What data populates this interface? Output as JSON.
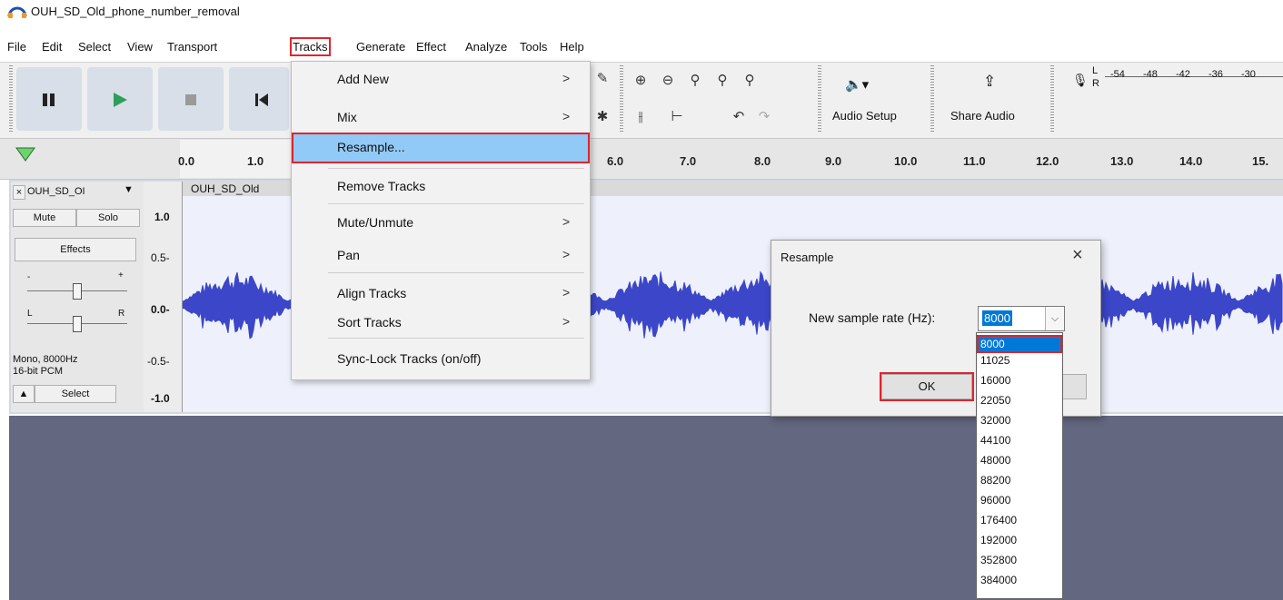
{
  "window": {
    "title": "OUH_SD_Old_phone_number_removal"
  },
  "menubar": [
    "File",
    "Edit",
    "Select",
    "View",
    "Transport",
    "Tracks",
    "Generate",
    "Effect",
    "Analyze",
    "Tools",
    "Help"
  ],
  "toolbar": {
    "audio_setup": "Audio Setup",
    "share_audio": "Share Audio",
    "meter_lr": [
      "L",
      "R"
    ],
    "meter_ticks": [
      "-54",
      "-48",
      "-42",
      "-36",
      "-30"
    ]
  },
  "timeline": {
    "ticks": [
      "0.0",
      "1.0",
      "6.0",
      "7.0",
      "8.0",
      "9.0",
      "10.0",
      "11.0",
      "12.0",
      "13.0",
      "14.0",
      "15."
    ]
  },
  "track": {
    "name": "OUH_SD_OI",
    "clip_name": "OUH_SD_Old",
    "mute": "Mute",
    "solo": "Solo",
    "effects": "Effects",
    "gain_minus": "-",
    "gain_plus": "+",
    "pan_left": "L",
    "pan_right": "R",
    "info_line1": "Mono, 8000Hz",
    "info_line2": "16-bit PCM",
    "select": "Select",
    "ruler": [
      "1.0",
      "0.5-",
      "0.0-",
      "-0.5-",
      "-1.0"
    ]
  },
  "tracks_menu": {
    "items": [
      {
        "label": "Add New",
        "submenu": ">"
      },
      {
        "label": "Mix",
        "submenu": ">"
      },
      {
        "label": "Resample...",
        "submenu": ""
      },
      {
        "label": "Remove Tracks",
        "submenu": ""
      },
      {
        "label": "Mute/Unmute",
        "submenu": ">"
      },
      {
        "label": "Pan",
        "submenu": ">"
      },
      {
        "label": "Align Tracks",
        "submenu": ">"
      },
      {
        "label": "Sort Tracks",
        "submenu": ">"
      },
      {
        "label": "Sync-Lock Tracks (on/off)",
        "submenu": ""
      }
    ]
  },
  "dialog": {
    "title": "Resample",
    "close": "×",
    "rate_label": "New sample rate (Hz):",
    "rate_value": "8000",
    "ok": "OK",
    "rate_options": [
      "8000",
      "11025",
      "16000",
      "22050",
      "32000",
      "44100",
      "48000",
      "88200",
      "96000",
      "176400",
      "192000",
      "352800",
      "384000"
    ]
  },
  "colors": {
    "accent": "#0078d7",
    "highlight_outline": "#e0242d",
    "waveform": "#3c46c8",
    "menu_hover": "#91c9f7"
  }
}
